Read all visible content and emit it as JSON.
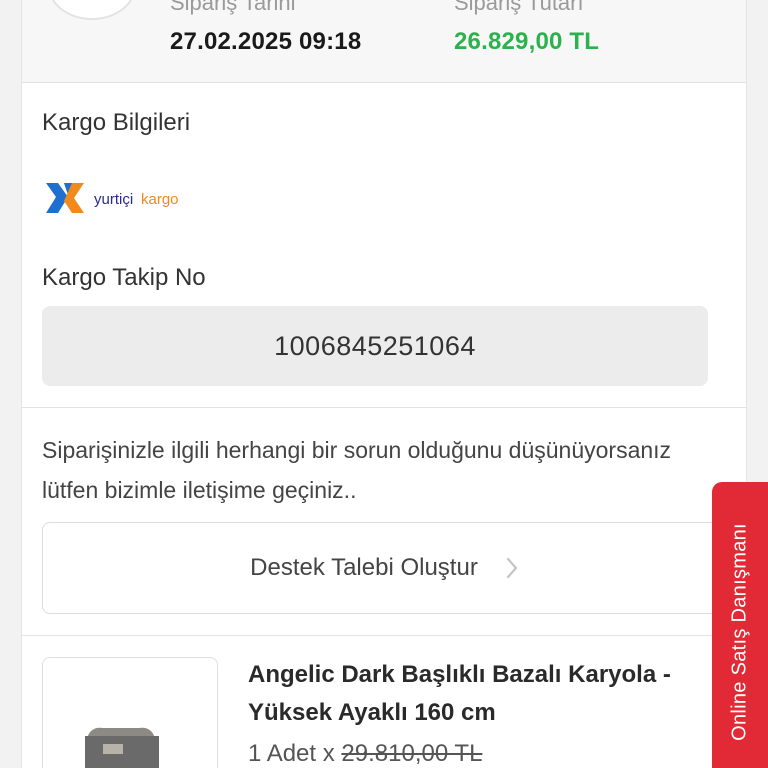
{
  "order_summary": {
    "date_label": "Sipariş Tarihi",
    "date_value": "27.02.2025 09:18",
    "total_label": "Sipariş Tutarı",
    "total_value": "26.829,00 TL",
    "total_color": "#2bb24c"
  },
  "cargo": {
    "section_title": "Kargo Bilgileri",
    "carrier_logo": "yurtiçikargo",
    "tracking_title": "Kargo Takip No",
    "tracking_number": "1006845251064"
  },
  "support": {
    "message": "Siparişinizle ilgili herhangi bir sorun olduğunu düşünüyorsanız lütfen bizimle iletişime geçiniz..",
    "button_label": "Destek Talebi Oluştur",
    "button_icon": "chevron-right-icon"
  },
  "product": {
    "name": "Angelic Dark Başlıklı Bazalı Karyola - Yüksek Ayaklı 160 cm",
    "quantity": "1 Adet",
    "multiplier": "x",
    "old_price": "29.810,00 TL"
  },
  "consult_tab": {
    "label": "Online Satış Danışmanı",
    "color": "#e22a36"
  }
}
